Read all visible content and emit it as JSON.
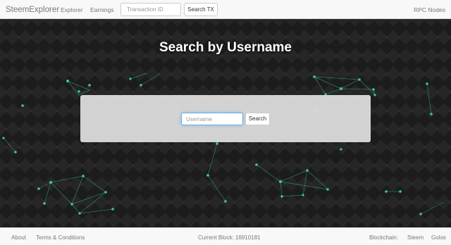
{
  "navbar": {
    "brand": "SteemExplorer",
    "links": [
      "Explorer",
      "Earnings"
    ],
    "tx_placeholder": "Transaction ID",
    "tx_button": "Search TX",
    "rpc_nodes": "RPC Nodes"
  },
  "hero": {
    "title": "Search by Username",
    "username_placeholder": "Username",
    "search_button": "Search"
  },
  "footer": {
    "about": "About",
    "terms": "Terms & Conditions",
    "current_block": "Current Block: 16910181",
    "blockchain_label": "Blockchain:",
    "chains": [
      "Steem",
      "Golos"
    ]
  },
  "colors": {
    "network_accent": "#3ec7a3",
    "focus_ring": "#66afe9"
  }
}
